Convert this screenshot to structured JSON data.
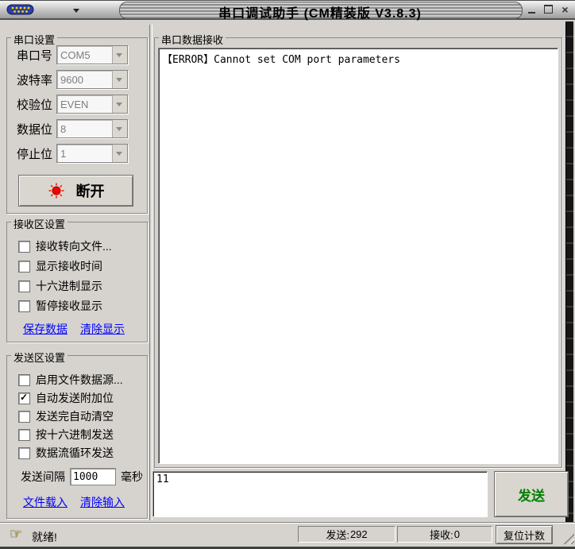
{
  "title_bar": {
    "title": "串口调试助手 (CM精装版 V3.8.3)"
  },
  "serial_settings": {
    "group_label": "串口设置",
    "fields": [
      {
        "label": "串口号",
        "value": "COM5"
      },
      {
        "label": "波特率",
        "value": "9600"
      },
      {
        "label": "校验位",
        "value": "EVEN"
      },
      {
        "label": "数据位",
        "value": "8"
      },
      {
        "label": "停止位",
        "value": "1"
      }
    ],
    "disconnect_button": "断开"
  },
  "receive_settings": {
    "group_label": "接收区设置",
    "checkboxes": [
      {
        "label": "接收转向文件...",
        "checked": false
      },
      {
        "label": "显示接收时间",
        "checked": false
      },
      {
        "label": "十六进制显示",
        "checked": false
      },
      {
        "label": "暂停接收显示",
        "checked": false
      }
    ],
    "links": [
      "保存数据",
      "清除显示"
    ]
  },
  "send_settings": {
    "group_label": "发送区设置",
    "checkboxes": [
      {
        "label": "启用文件数据源...",
        "checked": false
      },
      {
        "label": "自动发送附加位",
        "checked": true
      },
      {
        "label": "发送完自动清空",
        "checked": false
      },
      {
        "label": "按十六进制发送",
        "checked": false
      },
      {
        "label": "数据流循环发送",
        "checked": false
      }
    ],
    "interval_label": "发送间隔",
    "interval_value": "1000",
    "interval_unit": "毫秒",
    "links": [
      "文件载入",
      "清除输入"
    ]
  },
  "receive_area": {
    "group_label": "串口数据接收",
    "content": "【ERROR】Cannot set COM port parameters"
  },
  "send_area": {
    "input_value": "11",
    "send_button": "发送"
  },
  "status_bar": {
    "status": "就绪!",
    "sent": {
      "label": "发送:",
      "value": "292"
    },
    "received": {
      "label": "接收:",
      "value": "0"
    },
    "reset_button": "复位计数"
  },
  "colors": {
    "link": "#0000ff",
    "send_button_text": "#008000",
    "led": "#ff0000",
    "window_bg": "#d6d3ce"
  }
}
